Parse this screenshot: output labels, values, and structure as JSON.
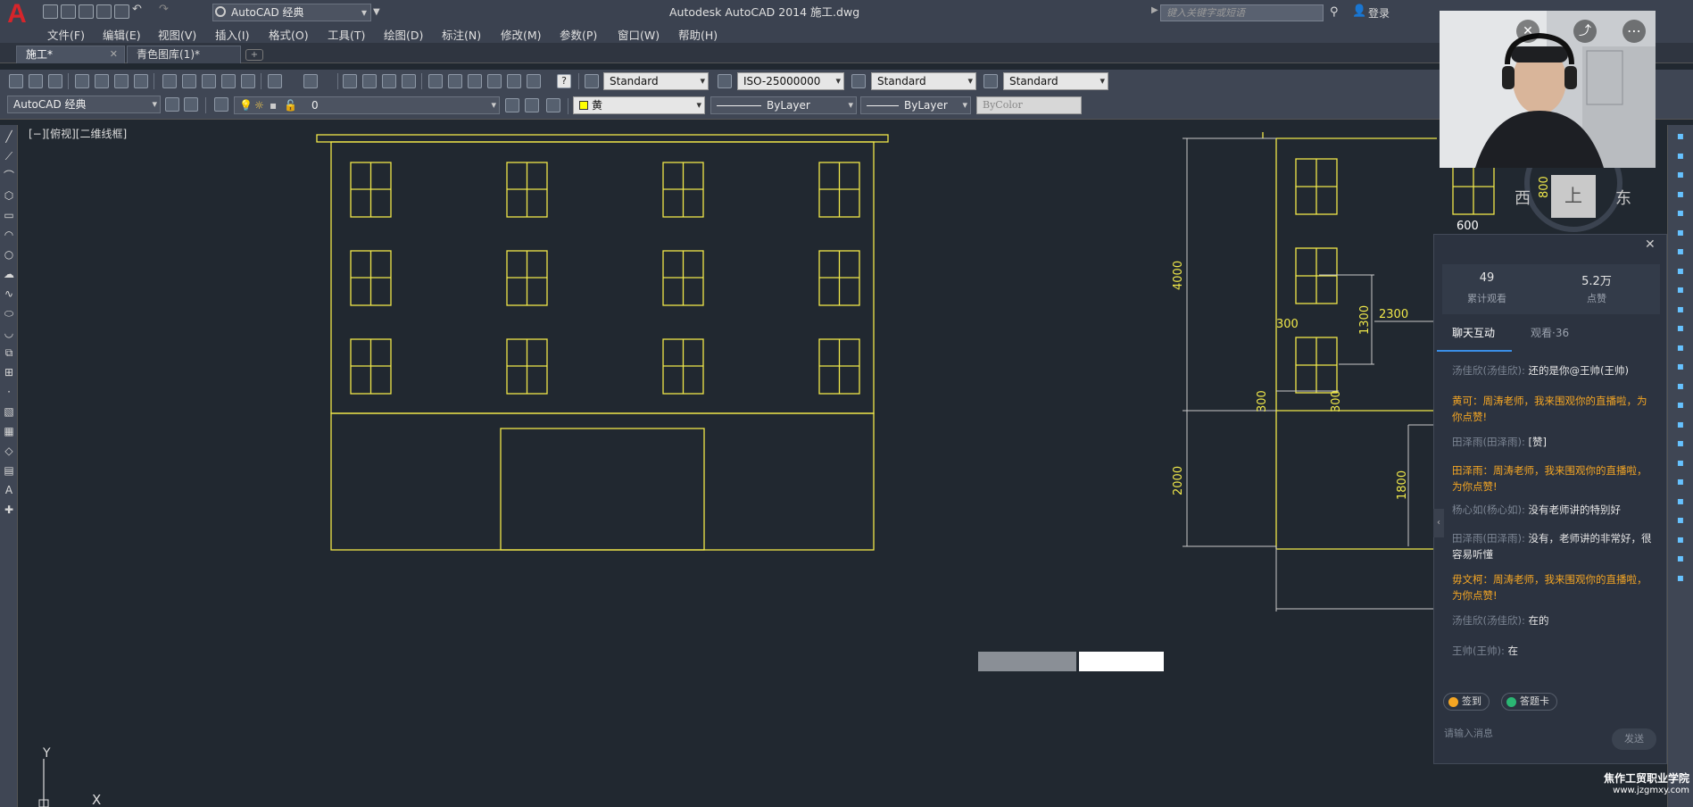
{
  "window": {
    "title": "Autodesk AutoCAD 2014    施工.dwg",
    "workspace": "AutoCAD 经典",
    "search_placeholder": "键入关键字或短语",
    "login": "登录"
  },
  "menu": [
    "文件(F)",
    "编辑(E)",
    "视图(V)",
    "插入(I)",
    "格式(O)",
    "工具(T)",
    "绘图(D)",
    "标注(N)",
    "修改(M)",
    "参数(P)",
    "窗口(W)",
    "帮助(H)"
  ],
  "tabs": [
    {
      "label": "施工*",
      "active": true
    },
    {
      "label": "青色图库(1)*",
      "active": false
    }
  ],
  "toolbar_row1": {
    "text_style": "Standard",
    "dim_style": "ISO-25000000",
    "table_style": "Standard",
    "mleader_style": "Standard"
  },
  "toolbar_row2": {
    "workspace": "AutoCAD 经典",
    "layer": "0",
    "color": "黄",
    "linetype": "ByLayer",
    "lineweight": "ByLayer",
    "plotstyle": "ByColor"
  },
  "viewport_label": "[−][俯视][二维线框]",
  "drawing": {
    "dim_labels": [
      "4000",
      "2000",
      "300",
      "1300",
      "300",
      "2300",
      "300",
      "1800",
      "800",
      "600"
    ],
    "ucs": {
      "y": "Y",
      "x": "X"
    }
  },
  "viewcube": {
    "west": "西",
    "top": "上",
    "east": "东"
  },
  "stream": {
    "stats": [
      {
        "value": "49",
        "label": "累计观看"
      },
      {
        "value": "5.2万",
        "label": "点赞"
      }
    ],
    "tabs": [
      "聊天互动",
      "观看·36"
    ],
    "messages": [
      {
        "nick": "汤佳欣(汤佳欣):",
        "text": "还的是你@王帅(王帅)",
        "gift": false
      },
      {
        "nick": "",
        "text": "黄可：周涛老师，我来围观你的直播啦，为你点赞!",
        "gift": true
      },
      {
        "nick": "田泽雨(田泽雨):",
        "text": "[赞]",
        "gift": false
      },
      {
        "nick": "",
        "text": "田泽雨：周涛老师，我来围观你的直播啦，为你点赞!",
        "gift": true
      },
      {
        "nick": "杨心如(杨心如):",
        "text": "没有老师讲的特别好",
        "gift": false
      },
      {
        "nick": "田泽雨(田泽雨):",
        "text": "没有，老师讲的非常好，很容易听懂",
        "gift": false
      },
      {
        "nick": "",
        "text": "毋文柯：周涛老师，我来围观你的直播啦，为你点赞!",
        "gift": true
      },
      {
        "nick": "汤佳欣(汤佳欣):",
        "text": "在的",
        "gift": false
      },
      {
        "nick": "王帅(王帅):",
        "text": "在",
        "gift": false
      }
    ],
    "buttons": [
      "签到",
      "答题卡"
    ],
    "input_placeholder": "请输入消息",
    "send": "发送"
  },
  "watermark": {
    "line1": "焦作工贸职业学院",
    "line2": "www.jzgmxy.com"
  },
  "colors": {
    "cad_yellow": "#ffff00",
    "canvas": "#212830",
    "gift": "#f5a623",
    "accent": "#3a8ee6"
  }
}
